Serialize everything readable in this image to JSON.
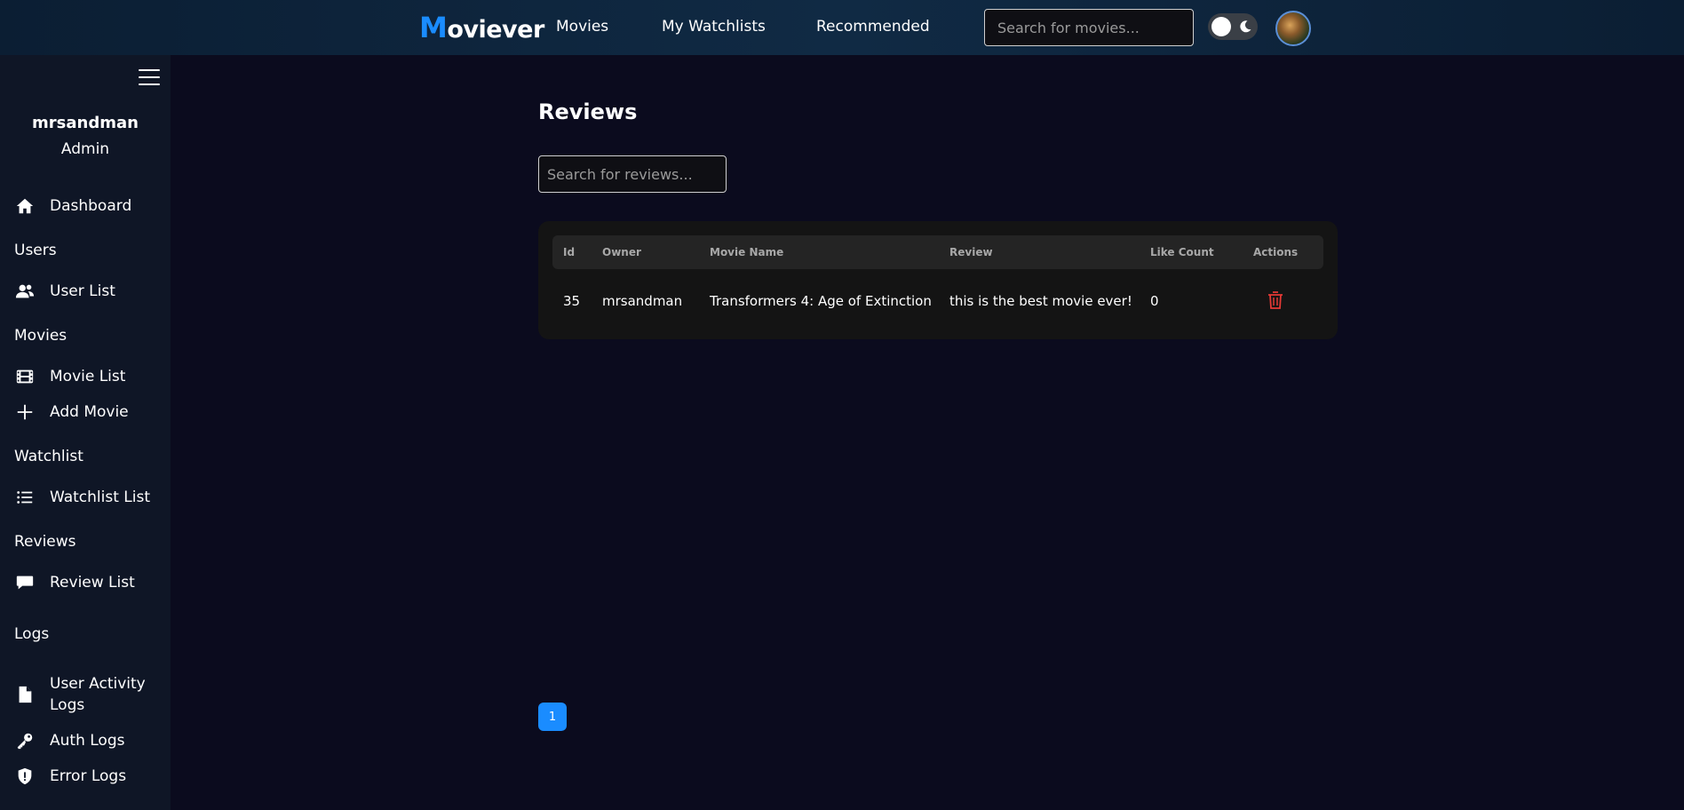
{
  "navbar": {
    "logo_first": "M",
    "logo_rest": "oviever",
    "links": [
      "Movies",
      "My Watchlists",
      "Recommended"
    ],
    "search_placeholder": "Search for movies..."
  },
  "sidebar": {
    "user_name": "mrsandman",
    "user_role": "Admin",
    "items": {
      "dashboard": "Dashboard",
      "users_section": "Users",
      "user_list": "User List",
      "movies_section": "Movies",
      "movie_list": "Movie List",
      "add_movie": "Add Movie",
      "watchlist_section": "Watchlist",
      "watchlist_list": "Watchlist List",
      "reviews_section": "Reviews",
      "review_list": "Review List",
      "logs_section": "Logs",
      "user_activity_logs": "User Activity Logs",
      "auth_logs": "Auth Logs",
      "error_logs": "Error Logs"
    },
    "icons": {
      "dashboard": "home-icon",
      "user_list": "users-icon",
      "movie_list": "film-icon",
      "add_movie": "plus-icon",
      "watchlist_list": "list-icon",
      "review_list": "comment-icon",
      "user_activity_logs": "file-icon",
      "auth_logs": "key-icon",
      "error_logs": "shield-icon"
    }
  },
  "main": {
    "title": "Reviews",
    "search_placeholder": "Search for reviews...",
    "table": {
      "headers": [
        "Id",
        "Owner",
        "Movie Name",
        "Review",
        "Like Count",
        "Actions"
      ],
      "rows": [
        {
          "id": "35",
          "owner": "mrsandman",
          "movie_name": "Transformers 4: Age of Extinction",
          "review": "this is the best movie ever!",
          "like_count": "0",
          "action_icon": "trash-icon"
        }
      ]
    },
    "pagination": {
      "current_page": "1"
    }
  },
  "colors": {
    "accent": "#1a8cff",
    "background": "#0b0b1e",
    "sidebar": "#0f1626",
    "navbar": "#102a44",
    "delete": "#e53935"
  }
}
